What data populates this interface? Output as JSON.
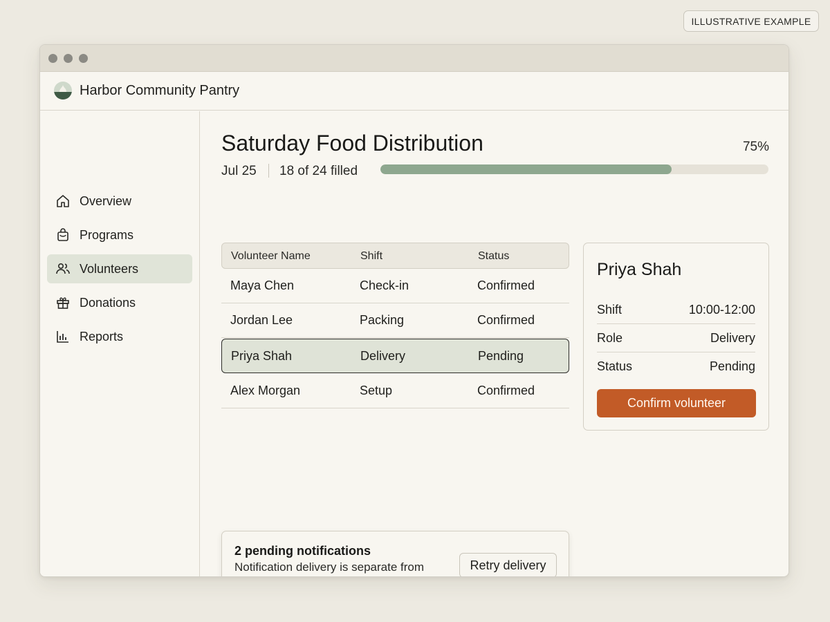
{
  "badge": "ILLUSTRATIVE EXAMPLE",
  "app": {
    "title": "Harbor Community Pantry"
  },
  "sidebar": {
    "items": [
      {
        "label": "Overview",
        "icon": "home-icon",
        "active": false
      },
      {
        "label": "Programs",
        "icon": "bag-icon",
        "active": false
      },
      {
        "label": "Volunteers",
        "icon": "users-icon",
        "active": true
      },
      {
        "label": "Donations",
        "icon": "gift-icon",
        "active": false
      },
      {
        "label": "Reports",
        "icon": "bar-chart-icon",
        "active": false
      }
    ]
  },
  "event": {
    "title": "Saturday Food Distribution",
    "date": "Jul 25",
    "filled": "18 of 24 filled",
    "progress_label": "75%",
    "progress_fraction": 0.75
  },
  "table": {
    "headers": [
      "Volunteer Name",
      "Shift",
      "Status"
    ],
    "rows": [
      {
        "name": "Maya Chen",
        "shift": "Check-in",
        "status": "Confirmed"
      },
      {
        "name": "Jordan Lee",
        "shift": "Packing",
        "status": "Confirmed"
      },
      {
        "name": "Priya Shah",
        "shift": "Delivery",
        "status": "Pending"
      },
      {
        "name": "Alex Morgan",
        "shift": "Setup",
        "status": "Confirmed"
      }
    ],
    "selected_index": 2
  },
  "detail": {
    "name": "Priya Shah",
    "fields": [
      {
        "key": "Shift",
        "value": "10:00-12:00"
      },
      {
        "key": "Role",
        "value": "Delivery"
      },
      {
        "key": "Status",
        "value": "Pending"
      }
    ],
    "confirm_label": "Confirm volunteer"
  },
  "notification": {
    "title": "2 pending notifications",
    "body": "Notification delivery is separate from saved records.",
    "retry_label": "Retry delivery"
  },
  "colors": {
    "accent": "#c25b27",
    "progress": "#8ea78f",
    "selected_row": "#dfe3d7",
    "active_nav": "#e0e4d8"
  }
}
